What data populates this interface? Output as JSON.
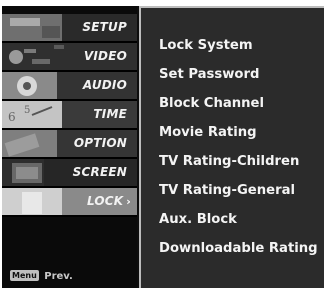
{
  "sidebar": {
    "tabs": [
      {
        "label": "SETUP",
        "icon": "setup-thumbnail-icon"
      },
      {
        "label": "VIDEO",
        "icon": "video-thumbnail-icon"
      },
      {
        "label": "AUDIO",
        "icon": "audio-thumbnail-icon"
      },
      {
        "label": "TIME",
        "icon": "time-thumbnail-icon"
      },
      {
        "label": "OPTION",
        "icon": "option-thumbnail-icon"
      },
      {
        "label": "SCREEN",
        "icon": "screen-thumbnail-icon"
      },
      {
        "label": "LOCK",
        "icon": "lock-thumbnail-icon",
        "active": true
      }
    ],
    "active_arrow": "›",
    "hint_key": "Menu",
    "hint_text": "Prev."
  },
  "lock_menu": {
    "items": [
      "Lock System",
      "Set Password",
      "Block Channel",
      "Movie Rating",
      "TV Rating-Children",
      "TV Rating-General",
      "Aux. Block",
      "Downloadable Rating"
    ]
  }
}
